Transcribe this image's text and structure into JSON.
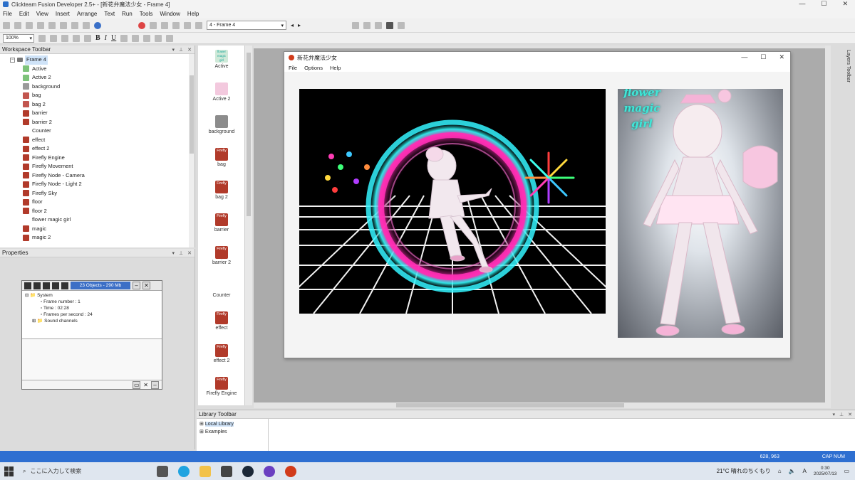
{
  "window": {
    "title": "Clickteam Fusion Developer 2.5+ - [新花弁魔法少女 - Frame 4]",
    "controls": [
      "—",
      "☐",
      "✕"
    ]
  },
  "menu": [
    "File",
    "Edit",
    "View",
    "Insert",
    "Arrange",
    "Text",
    "Run",
    "Tools",
    "Window",
    "Help"
  ],
  "toolbar": {
    "frame_select": "4 - Frame 4",
    "zoom": "100%",
    "bold": "B",
    "italic": "I",
    "underline": "U"
  },
  "workspace": {
    "header": "Workspace Toolbar",
    "root": "Frame 4",
    "items": [
      {
        "label": "Active",
        "icon": "active-icon"
      },
      {
        "label": "Active 2",
        "icon": "active-icon"
      },
      {
        "label": "background",
        "icon": "backdrop-icon"
      },
      {
        "label": "bag",
        "icon": "bag-icon"
      },
      {
        "label": "bag 2",
        "icon": "bag-icon"
      },
      {
        "label": "barrier",
        "icon": "firefly-icon"
      },
      {
        "label": "barrier 2",
        "icon": "firefly-icon"
      },
      {
        "label": "Counter",
        "icon": "counter-icon"
      },
      {
        "label": "effect",
        "icon": "firefly-icon"
      },
      {
        "label": "effect 2",
        "icon": "firefly-icon"
      },
      {
        "label": "Firefly Engine",
        "icon": "firefly-icon"
      },
      {
        "label": "Firefly Movement",
        "icon": "firefly-icon"
      },
      {
        "label": "Firefly Node - Camera",
        "icon": "firefly-icon"
      },
      {
        "label": "Firefly Node - Light 2",
        "icon": "firefly-icon"
      },
      {
        "label": "Firefly Sky",
        "icon": "firefly-icon"
      },
      {
        "label": "floor",
        "icon": "firefly-icon"
      },
      {
        "label": "floor 2",
        "icon": "firefly-icon"
      },
      {
        "label": "flower magic girl",
        "icon": "string-icon"
      },
      {
        "label": "magic",
        "icon": "firefly-icon"
      },
      {
        "label": "magic    2",
        "icon": "firefly-icon"
      }
    ]
  },
  "properties": {
    "header": "Properties"
  },
  "debugger": {
    "status": "23 Objects - 290 Mb",
    "tree": {
      "root": "System",
      "frame_number": "Frame number : 1",
      "time": "Time : 02:28",
      "fps": "Frames per second : 24",
      "sound": "Sound channels"
    }
  },
  "object_list": [
    {
      "label": "Active"
    },
    {
      "label": "Active 2"
    },
    {
      "label": "background"
    },
    {
      "label": "bag"
    },
    {
      "label": "bag 2"
    },
    {
      "label": "barrier"
    },
    {
      "label": "barrier 2"
    },
    {
      "label": "Counter"
    },
    {
      "label": "effect"
    },
    {
      "label": "effect 2"
    },
    {
      "label": "Firefly Engine"
    }
  ],
  "object_list_thumb_text": "flower magic girl",
  "firefly_badge": "Firefly",
  "run_window": {
    "title": "新花弁魔法少女",
    "menu": [
      "File",
      "Options",
      "Help"
    ],
    "portrait_title": "flower magic girl"
  },
  "library": {
    "header": "Library Toolbar",
    "items": [
      "Local Library",
      "Examples"
    ]
  },
  "layers_tab": "Layers Toolbar",
  "status": {
    "coords": "628, 963",
    "caps": "CAP NUM"
  },
  "taskbar": {
    "search_placeholder": "ここに入力して検索",
    "weather": "21°C  晴れのちくもり",
    "time": "0:30",
    "date": "2025/07/13",
    "ime": "A"
  }
}
